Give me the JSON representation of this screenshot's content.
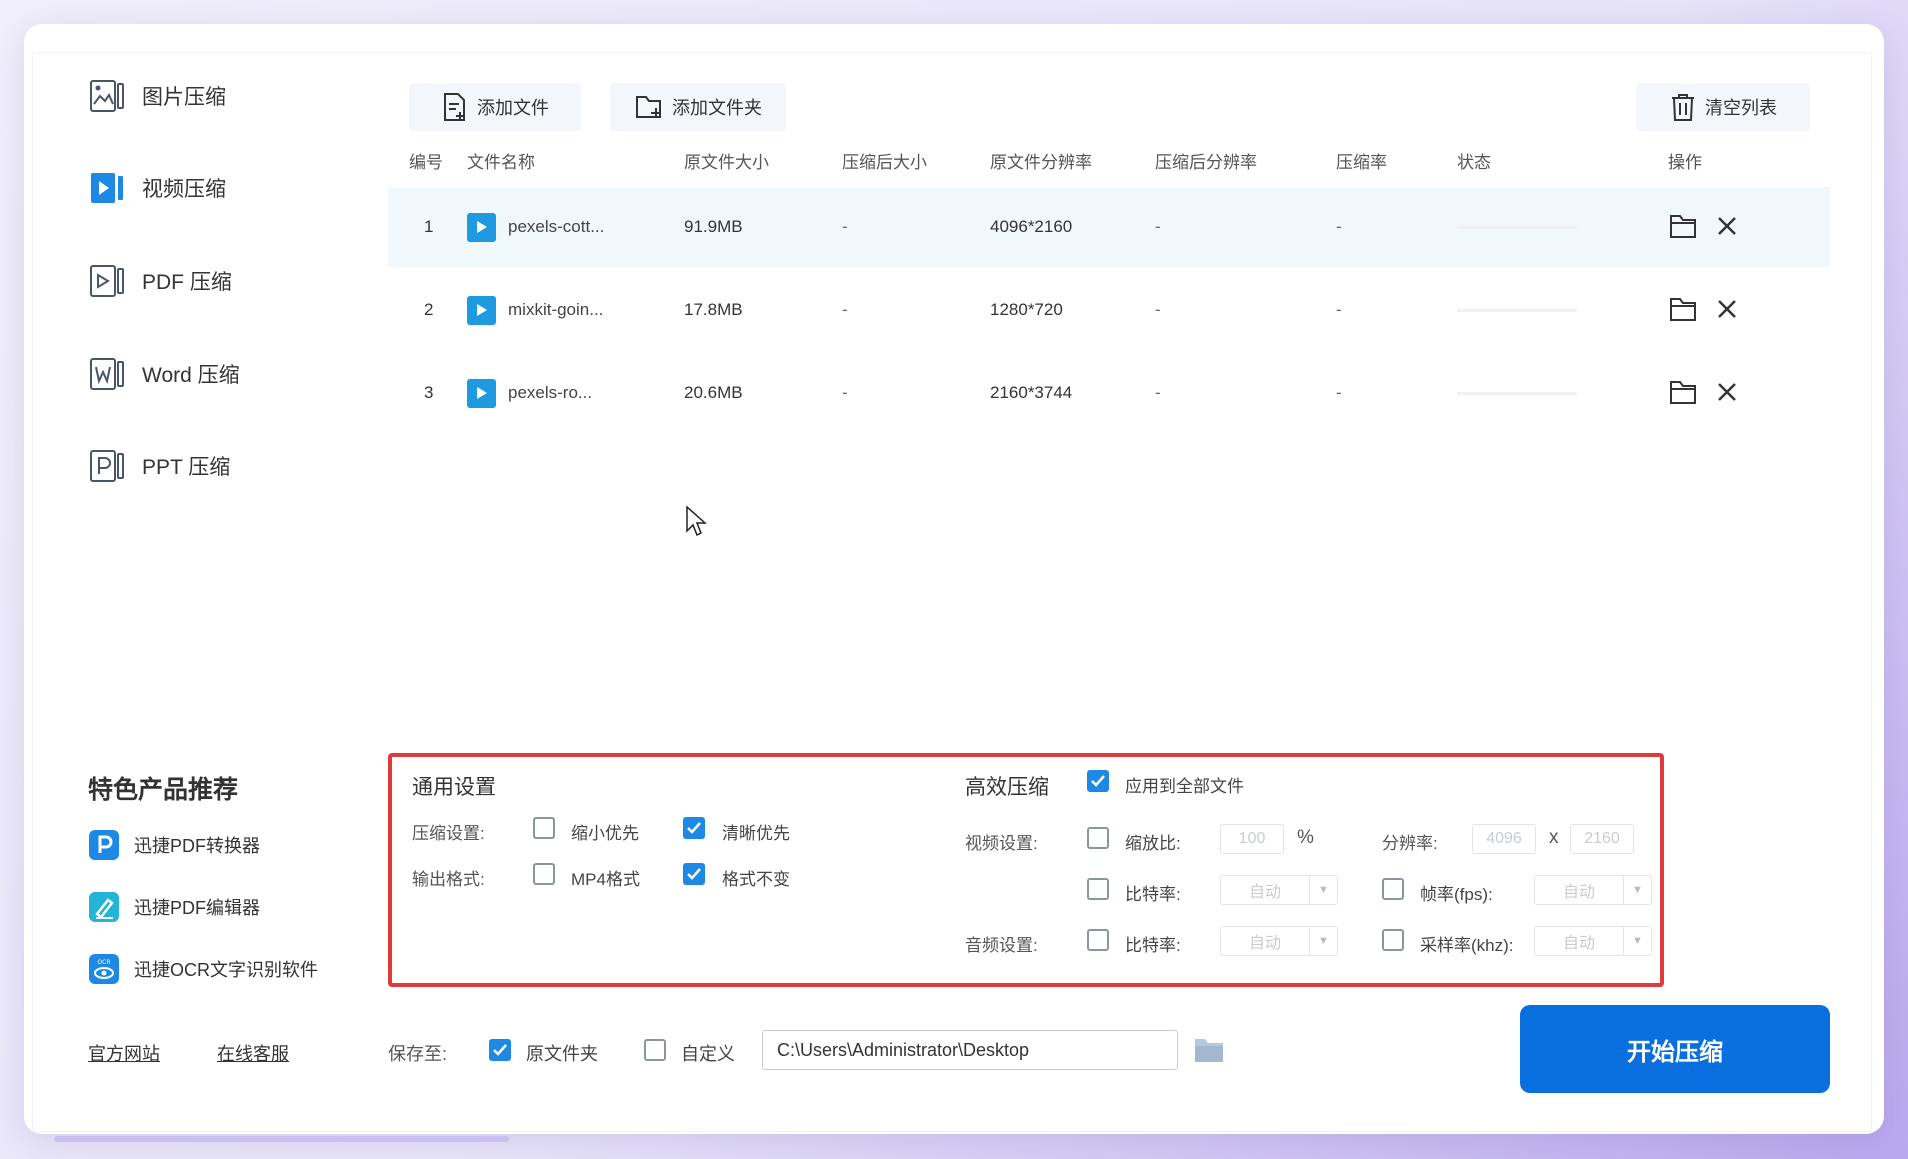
{
  "sidebar": {
    "items": [
      {
        "label": "图片压缩",
        "icon": "image-compress-icon"
      },
      {
        "label": "视频压缩",
        "icon": "video-compress-icon",
        "active": true
      },
      {
        "label": "PDF 压缩",
        "icon": "pdf-compress-icon"
      },
      {
        "label": "Word 压缩",
        "icon": "word-compress-icon"
      },
      {
        "label": "PPT 压缩",
        "icon": "ppt-compress-icon"
      }
    ],
    "recommend_title": "特色产品推荐",
    "recommend": [
      {
        "label": "迅捷PDF转换器",
        "icon": "pdf-converter-icon"
      },
      {
        "label": "迅捷PDF编辑器",
        "icon": "pdf-editor-icon"
      },
      {
        "label": "迅捷OCR文字识别软件",
        "icon": "ocr-icon"
      }
    ],
    "links": {
      "official": "官方网站",
      "support": "在线客服"
    }
  },
  "toolbar": {
    "add_file": "添加文件",
    "add_folder": "添加文件夹",
    "clear_list": "清空列表"
  },
  "table": {
    "headers": [
      "编号",
      "文件名称",
      "原文件大小",
      "压缩后大小",
      "原文件分辨率",
      "压缩后分辨率",
      "压缩率",
      "状态",
      "操作"
    ],
    "rows": [
      {
        "index": "1",
        "name": "pexels-cott...",
        "size": "91.9MB",
        "compressed_size": "-",
        "resolution": "4096*2160",
        "compressed_resolution": "-",
        "ratio": "-"
      },
      {
        "index": "2",
        "name": "mixkit-goin...",
        "size": "17.8MB",
        "compressed_size": "-",
        "resolution": "1280*720",
        "compressed_resolution": "-",
        "ratio": "-"
      },
      {
        "index": "3",
        "name": "pexels-ro...",
        "size": "20.6MB",
        "compressed_size": "-",
        "resolution": "2160*3744",
        "compressed_resolution": "-",
        "ratio": "-"
      }
    ]
  },
  "general": {
    "title": "通用设置",
    "compress_label": "压缩设置:",
    "opt_small": "缩小优先",
    "opt_clear": "清晰优先",
    "format_label": "输出格式:",
    "opt_mp4": "MP4格式",
    "opt_keep": "格式不变"
  },
  "advanced": {
    "title": "高效压缩",
    "apply_all": "应用到全部文件",
    "video_label": "视频设置:",
    "scale_label": "缩放比:",
    "scale_value": "100",
    "scale_unit": "%",
    "resolution_label": "分辨率:",
    "res_w": "4096",
    "res_x": "x",
    "res_h": "2160",
    "bitrate_label": "比特率:",
    "auto": "自动",
    "fps_label": "帧率(fps):",
    "audio_label": "音频设置:",
    "audio_bitrate_label": "比特率:",
    "sample_label": "采样率(khz):"
  },
  "save": {
    "label": "保存至:",
    "opt_original": "原文件夹",
    "opt_custom": "自定义",
    "path": "C:\\Users\\Administrator\\Desktop"
  },
  "start_button": "开始压缩",
  "colors": {
    "accent": "#0a6fde",
    "highlight_border": "#e13a3a",
    "play": "#1e9ae0"
  }
}
